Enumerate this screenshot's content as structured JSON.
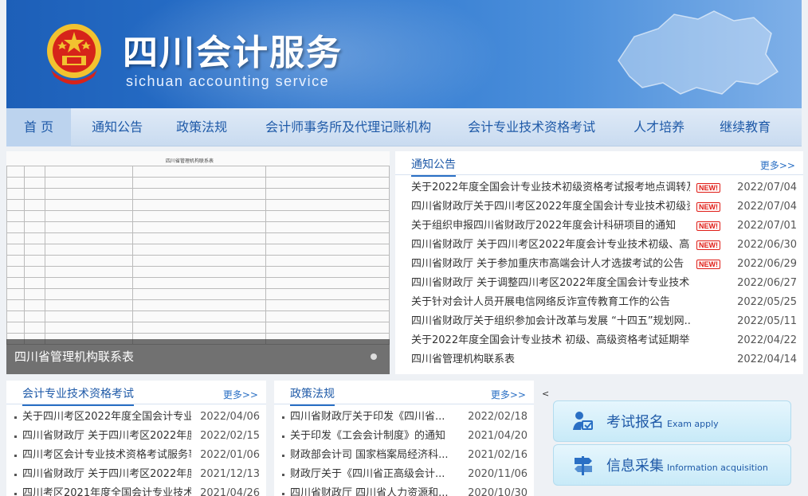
{
  "header": {
    "title": "四川会计服务",
    "subtitle": "sichuan accounting service",
    "emblem_icon": "national-emblem-icon",
    "map_icon": "sichuan-map-icon"
  },
  "nav": {
    "items": [
      {
        "label": "首 页"
      },
      {
        "label": "通知公告"
      },
      {
        "label": "政策法规"
      },
      {
        "label": "会计师事务所及代理记账机构"
      },
      {
        "label": "会计专业技术资格考试"
      },
      {
        "label": "人才培养"
      },
      {
        "label": "继续教育"
      }
    ]
  },
  "slide": {
    "doc_title": "四川省管理机构联系表",
    "caption": "四川省管理机构联系表"
  },
  "notices": {
    "title": "通知公告",
    "more": "更多>>",
    "badge": "NEW!",
    "items": [
      {
        "title": "关于2022年度全国会计专业技术初级资格考试报考地点调转及...",
        "date": "2022/07/04",
        "new": true
      },
      {
        "title": "四川省财政厅关于四川考区2022年度全国会计专业技术初级资...",
        "date": "2022/07/04",
        "new": true
      },
      {
        "title": "关于组织申报四川省财政厅2022年度会计科研项目的通知",
        "date": "2022/07/01",
        "new": true
      },
      {
        "title": "四川省财政厅 关于四川考区2022年度会计专业技术初级、高级...",
        "date": "2022/06/30",
        "new": true
      },
      {
        "title": "四川省财政厅 关于参加重庆市高端会计人才选拔考试的公告",
        "date": "2022/06/29",
        "new": true
      },
      {
        "title": "四川省财政厅 关于调整四川考区2022年度全国会计专业技术初...",
        "date": "2022/06/27",
        "new": false
      },
      {
        "title": "关于针对会计人员开展电信网络反诈宣传教育工作的公告",
        "date": "2022/05/25",
        "new": false
      },
      {
        "title": "四川省财政厅关于组织参加会计改革与发展 “十四五”规划网...",
        "date": "2022/05/11",
        "new": false
      },
      {
        "title": "关于2022年度全国会计专业技术 初级、高级资格考试延期举行...",
        "date": "2022/04/22",
        "new": false
      },
      {
        "title": "四川省管理机构联系表",
        "date": "2022/04/14",
        "new": false
      }
    ]
  },
  "exam": {
    "title": "会计专业技术资格考试",
    "more": "更多>>",
    "items": [
      {
        "title": "关于四川考区2022年度全国会计专业...",
        "date": "2022/04/06"
      },
      {
        "title": "四川省财政厅 关于四川考区2022年度...",
        "date": "2022/02/15"
      },
      {
        "title": "四川考区会计专业技术资格考试服务事...",
        "date": "2022/01/06"
      },
      {
        "title": "四川省财政厅 关于四川考区2022年度...",
        "date": "2021/12/13"
      },
      {
        "title": "四川考区2021年度全国会计专业技术...",
        "date": "2021/04/26"
      }
    ]
  },
  "policy": {
    "title": "政策法规",
    "more": "更多>>",
    "items": [
      {
        "title": "四川省财政厅关于印发《四川省...",
        "date": "2022/02/18"
      },
      {
        "title": "关于印发《工会会计制度》的通知",
        "date": "2021/04/20"
      },
      {
        "title": "财政部会计司 国家档案局经济科...",
        "date": "2021/02/16"
      },
      {
        "title": "财政厅关于《四川省正高级会计...",
        "date": "2020/11/06"
      },
      {
        "title": "四川省财政厅 四川省人力资源和...",
        "date": "2020/10/30"
      }
    ]
  },
  "quick": {
    "arrow": "<",
    "items": [
      {
        "label": "考试报名",
        "en": "Exam apply",
        "icon": "exam-apply-icon"
      },
      {
        "label": "信息采集",
        "en": "Information acquisition",
        "icon": "signpost-icon"
      }
    ]
  },
  "colors": {
    "brand": "#1f5aa8",
    "badge": "#e0201a",
    "header": "#2a73cc"
  }
}
